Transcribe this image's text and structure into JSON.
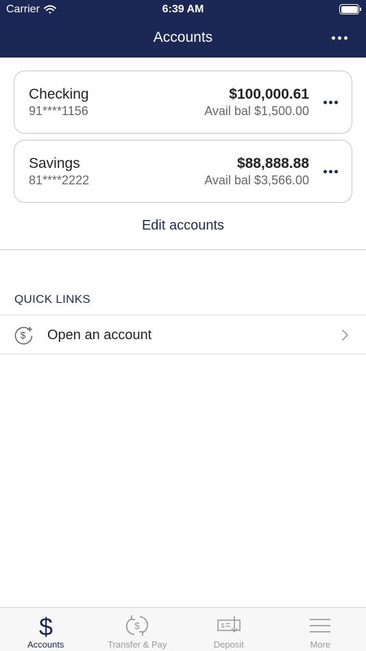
{
  "status_bar": {
    "carrier": "Carrier",
    "time": "6:39 AM"
  },
  "nav": {
    "title": "Accounts"
  },
  "accounts": [
    {
      "name": "Checking",
      "number": "91****1156",
      "balance": "$100,000.61",
      "available": "Avail bal $1,500.00"
    },
    {
      "name": "Savings",
      "number": "81****2222",
      "balance": "$88,888.88",
      "available": "Avail bal $3,566.00"
    }
  ],
  "edit_accounts_label": "Edit accounts",
  "quick_links": {
    "title": "QUICK LINKS",
    "items": [
      {
        "label": "Open an account",
        "icon": "dollar-plus-icon"
      }
    ]
  },
  "tabbar": {
    "tabs": [
      {
        "label": "Accounts",
        "icon": "dollar-icon",
        "active": true
      },
      {
        "label": "Transfer & Pay",
        "icon": "transfer-icon",
        "active": false
      },
      {
        "label": "Deposit",
        "icon": "check-deposit-icon",
        "active": false
      },
      {
        "label": "More",
        "icon": "menu-icon",
        "active": false
      }
    ]
  },
  "colors": {
    "brand_navy": "#1b2856",
    "inactive_gray": "#9a9a9a"
  }
}
